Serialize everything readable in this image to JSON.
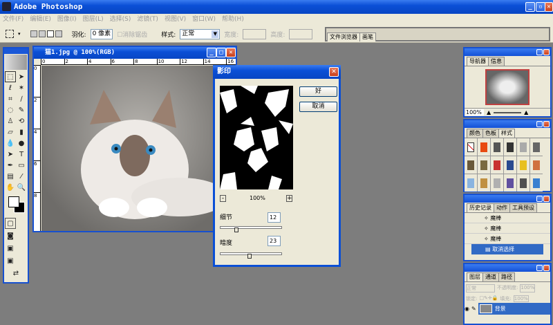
{
  "app": {
    "title": "Adobe Photoshop"
  },
  "menu": [
    "文件(F)",
    "编辑(E)",
    "图像(I)",
    "图层(L)",
    "选择(S)",
    "滤镜(T)",
    "视图(V)",
    "窗口(W)",
    "帮助(H)"
  ],
  "options": {
    "feather_label": "羽化:",
    "feather_value": "0 像素",
    "antialias_label": "消除锯齿",
    "style_label": "样式:",
    "style_value": "正常",
    "width_label": "宽度:",
    "height_label": "高度:"
  },
  "palette_well": {
    "tabs": [
      "文件浏览器",
      "画笔"
    ]
  },
  "document": {
    "title": "猫1.jpg @ 100%(RGB)",
    "ruler_h": [
      "0",
      "2",
      "4",
      "6",
      "8",
      "10",
      "12",
      "14",
      "16"
    ],
    "ruler_v": [
      "0",
      "2",
      "4",
      "6",
      "8"
    ]
  },
  "dialog": {
    "title": "影印",
    "ok": "好",
    "cancel": "取消",
    "zoom": "100%",
    "zoom_out": "-",
    "zoom_in": "+",
    "detail_label": "细节",
    "detail_value": "12",
    "darkness_label": "暗度",
    "darkness_value": "23",
    "detail_fraction": 0.24,
    "darkness_fraction": 0.46
  },
  "navigator": {
    "tabs": [
      "导航器",
      "信息"
    ],
    "zoom": "100%"
  },
  "styles": {
    "tabs": [
      "颜色",
      "色板",
      "样式"
    ],
    "swatches": [
      "#fff",
      "#e84a10",
      "#555",
      "#333",
      "#aaa",
      "#666",
      "#6b5a3a",
      "#7a6a40",
      "#c83030",
      "#2a4a90",
      "#e8c020",
      "#d07040",
      "#8ab4e0",
      "#c09040",
      "#b0b0b0",
      "#6050a0",
      "#505050",
      "#3a80d0"
    ]
  },
  "history": {
    "tabs": [
      "历史记录",
      "动作",
      "工具预设"
    ],
    "items": [
      "魔棒",
      "魔棒",
      "魔棒",
      "取消选择"
    ]
  },
  "layers": {
    "tabs": [
      "图层",
      "通道",
      "路径"
    ],
    "mode": "正常",
    "opacity_label": "不透明度:",
    "opacity": "100%",
    "lock_label": "锁定:",
    "fill_label": "填充:",
    "fill": "100%",
    "layer_name": "背景"
  },
  "colors": {
    "accent": "#0a4fd6",
    "workspace": "#7d7d7d",
    "panel": "#ece9d8",
    "selected": "#316ac5"
  }
}
